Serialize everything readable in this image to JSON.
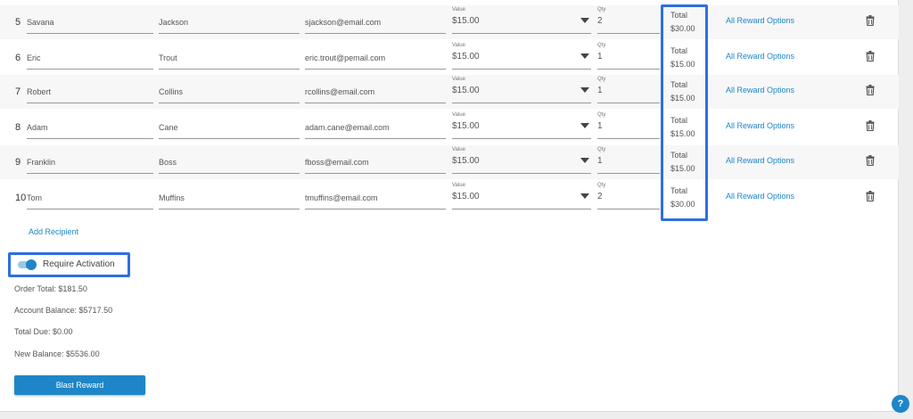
{
  "labels": {
    "value_tiny": "Value",
    "qty_tiny": "Qty",
    "total_label": "Total",
    "reward_link": "All Reward Options"
  },
  "rows": [
    {
      "num": "5",
      "first": "Savana",
      "last": "Jackson",
      "email": "sjackson@email.com",
      "value": "$15.00",
      "qty": "2",
      "total": "$30.00"
    },
    {
      "num": "6",
      "first": "Eric",
      "last": "Trout",
      "email": "eric.trout@pemail.com",
      "value": "$15.00",
      "qty": "1",
      "total": "$15.00"
    },
    {
      "num": "7",
      "first": "Robert",
      "last": "Collins",
      "email": "rcollins@email.com",
      "value": "$15.00",
      "qty": "1",
      "total": "$15.00"
    },
    {
      "num": "8",
      "first": "Adam",
      "last": "Cane",
      "email": "adam.cane@email.com",
      "value": "$15.00",
      "qty": "1",
      "total": "$15.00"
    },
    {
      "num": "9",
      "first": "Franklin",
      "last": "Boss",
      "email": "fboss@email.com",
      "value": "$15.00",
      "qty": "1",
      "total": "$15.00"
    },
    {
      "num": "10",
      "first": "Tom",
      "last": "Muffins",
      "email": "tmuffins@email.com",
      "value": "$15.00",
      "qty": "2",
      "total": "$30.00"
    }
  ],
  "add_recipient": "Add Recipient",
  "require_activation": {
    "label": "Require Activation",
    "enabled": true
  },
  "summary": {
    "order_total": "Order Total: $181.50",
    "account_balance": "Account Balance: $5717.50",
    "total_due": "Total Due: $0.00",
    "new_balance": "New Balance: $5536.00"
  },
  "blast_button": "Blast Reward",
  "help_button": "?",
  "icons": {
    "delete": "trash-icon",
    "dropdown": "caret-down-icon"
  },
  "colors": {
    "accent": "#1e86c8",
    "highlight": "#2d6fe0"
  }
}
